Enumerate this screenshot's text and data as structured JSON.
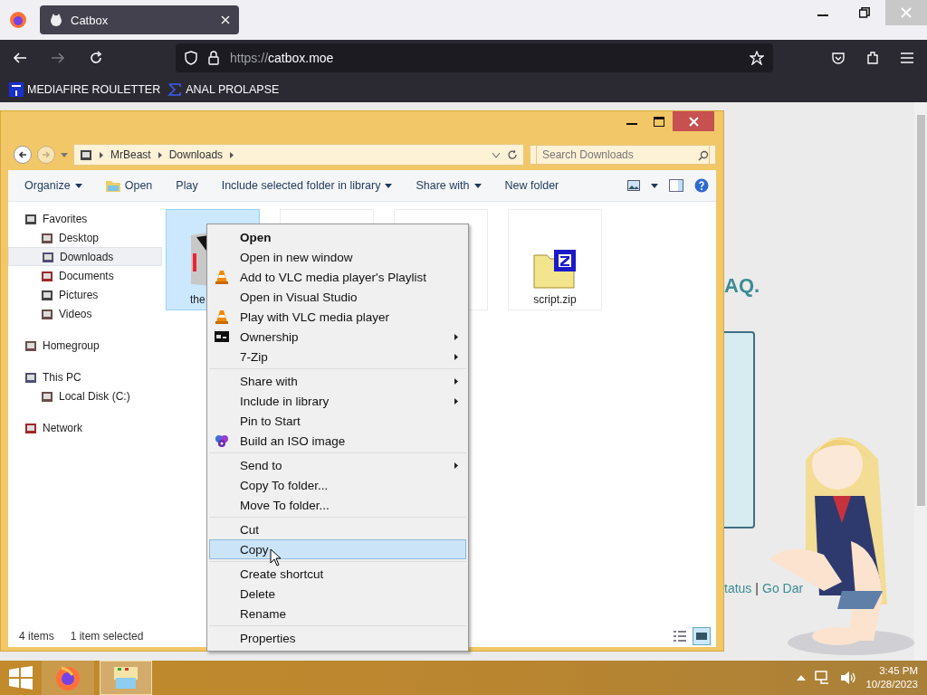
{
  "browser": {
    "tab": {
      "title": "Catbox",
      "selected": true
    },
    "url_scheme": "https://",
    "url_host": "catbox.moe",
    "bookmarks": [
      {
        "label": "MEDIAFIRE ROULETTER"
      },
      {
        "label": "ANAL PROLAPSE"
      }
    ]
  },
  "webpage": {
    "heading_fragment": "AQ.",
    "footer": [
      {
        "kind": "link",
        "text": "tatus"
      },
      {
        "kind": "sep",
        "text": "|"
      },
      {
        "kind": "link",
        "text": "Go Dar"
      }
    ]
  },
  "explorer": {
    "breadcrumb": [
      "MrBeast",
      "Downloads"
    ],
    "search": {
      "placeholder": "Search Downloads"
    },
    "toolbar": [
      {
        "label": "Organize",
        "dropdown": true
      },
      {
        "label": "Open",
        "dropdown": false
      },
      {
        "label": "Play",
        "dropdown": false
      },
      {
        "label": "Include selected folder in library",
        "dropdown": true
      },
      {
        "label": "Share with",
        "dropdown": true
      },
      {
        "label": "New folder",
        "dropdown": false
      }
    ],
    "nav": [
      {
        "label": "Favorites",
        "children": [
          {
            "label": "Desktop",
            "selected": false
          },
          {
            "label": "Downloads",
            "selected": true
          },
          {
            "label": "Documents",
            "selected": false
          },
          {
            "label": "Pictures",
            "selected": false
          },
          {
            "label": "Videos",
            "selected": false
          }
        ]
      },
      {
        "label": "Homegroup"
      },
      {
        "label": "This PC",
        "children": [
          {
            "label": "Local Disk (C:)",
            "selected": false
          }
        ]
      },
      {
        "label": "Network"
      }
    ],
    "files": [
      {
        "name": "the",
        "selected": true
      },
      {
        "selected": false
      },
      {
        "selected": false
      },
      {
        "name": "script.zip",
        "selected": false
      }
    ],
    "status": {
      "count": "4 items",
      "selection": "1 item selected"
    }
  },
  "context_menu": {
    "groups": [
      [
        {
          "label": "Open",
          "default": true,
          "submenu": false,
          "selected": false
        },
        {
          "label": "Open in new window",
          "default": false,
          "submenu": false,
          "selected": false
        },
        {
          "label": "Add to VLC media player's Playlist",
          "default": false,
          "submenu": false,
          "selected": false
        },
        {
          "label": "Open in Visual Studio",
          "default": false,
          "submenu": false,
          "selected": false
        },
        {
          "label": "Play with VLC media player",
          "default": false,
          "submenu": false,
          "selected": false
        },
        {
          "label": "Ownership",
          "default": false,
          "submenu": true,
          "selected": false
        },
        {
          "label": "7-Zip",
          "default": false,
          "submenu": true,
          "selected": false
        }
      ],
      [
        {
          "label": "Share with",
          "default": false,
          "submenu": true,
          "selected": false
        },
        {
          "label": "Include in library",
          "default": false,
          "submenu": true,
          "selected": false
        },
        {
          "label": "Pin to Start",
          "default": false,
          "submenu": false,
          "selected": false
        },
        {
          "label": "Build an ISO image",
          "default": false,
          "submenu": false,
          "selected": false
        }
      ],
      [
        {
          "label": "Send to",
          "default": false,
          "submenu": true,
          "selected": false
        },
        {
          "label": "Copy To folder...",
          "default": false,
          "submenu": false,
          "selected": false
        },
        {
          "label": "Move To folder...",
          "default": false,
          "submenu": false,
          "selected": false
        }
      ],
      [
        {
          "label": "Cut",
          "default": false,
          "submenu": false,
          "selected": false
        },
        {
          "label": "Copy",
          "default": false,
          "submenu": false,
          "selected": true
        }
      ],
      [
        {
          "label": "Create shortcut",
          "default": false,
          "submenu": false,
          "selected": false
        },
        {
          "label": "Delete",
          "default": false,
          "submenu": false,
          "selected": false
        },
        {
          "label": "Rename",
          "default": false,
          "submenu": false,
          "selected": false
        }
      ],
      [
        {
          "label": "Properties",
          "default": false,
          "submenu": false,
          "selected": false
        }
      ]
    ]
  },
  "taskbar": {
    "apps": [
      {
        "selected": false
      },
      {
        "selected": true
      }
    ],
    "time": "3:45 PM",
    "date": "10/28/2023"
  }
}
